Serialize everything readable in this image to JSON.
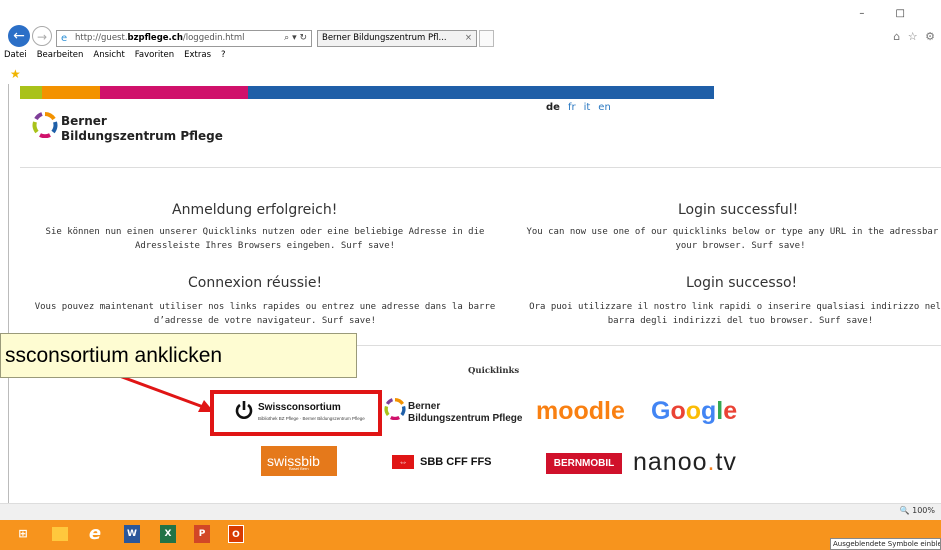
{
  "browser": {
    "address_prefix": "http://guest.",
    "address_domain": "bzpflege.ch",
    "address_path": "/loggedin.html",
    "address_controls": "⌕ ▾ ↻",
    "tab_title": "Berner Bildungszentrum Pfl...",
    "tab_close": "×",
    "window_controls": "– □",
    "toolbar_icons": "⌂ ☆ ⚙",
    "menu": [
      "Datei",
      "Bearbeiten",
      "Ansicht",
      "Favoriten",
      "Extras",
      "?"
    ],
    "zoom": "100%"
  },
  "colors": {
    "bar1": "#a9c21a",
    "bar2": "#f39200",
    "bar3": "#d0116b",
    "bar4": "#7e3f98",
    "bar5": "#1f5fa8",
    "taskbar": "#f7941d"
  },
  "header": {
    "languages": [
      "de",
      "fr",
      "it",
      "en"
    ],
    "active_language": "de",
    "logo_line1": "Berner",
    "logo_line2": "Bildungszentrum Pflege"
  },
  "messages": {
    "de_title": "Anmeldung erfolgreich!",
    "de_text": "Sie können nun einen unserer Quicklinks nutzen oder eine beliebige Adresse in die Adressleiste Ihres Browsers eingeben. Surf save!",
    "en_title": "Login successful!",
    "en_text": "You can now use one of our quicklinks below or type any URL in the adressbar of your browser. Surf save!",
    "fr_title": "Connexion réussie!",
    "fr_text": "Vous pouvez maintenant utiliser nos links rapides ou entrez une adresse dans la barre d’adresse de votre navigateur. Surf save!",
    "it_title": "Login successo!",
    "it_text": "Ora puoi utilizzare il nostro link rapidi o inserire qualsiasi indirizzo nella barra degli indirizzi del tuo browser. Surf save!"
  },
  "quicklinks": {
    "label": "Quicklinks",
    "swissconsortium_name": "Swissconsortium",
    "swissconsortium_sub": "Bibliothek BZ Pflege · Berner Bildungszentrum Pflege",
    "bzp_line1": "Berner",
    "bzp_line2": "Bildungszentrum Pflege",
    "moodle": "moodle",
    "google_letters": [
      "G",
      "o",
      "o",
      "g",
      "l",
      "e"
    ],
    "swissbib": "swissbib",
    "swissbib_sub": "Basel Bern",
    "sbb": "SBB CFF FFS",
    "bernmobil": "BERNMOBIL",
    "nanoo_a": "nanoo",
    "nanoo_dot": ".",
    "nanoo_b": "tv"
  },
  "annotation": {
    "callout_text": "ssconsortium anklicken"
  },
  "taskbar": {
    "tooltip": "Ausgeblendete Symbole einblenden"
  }
}
